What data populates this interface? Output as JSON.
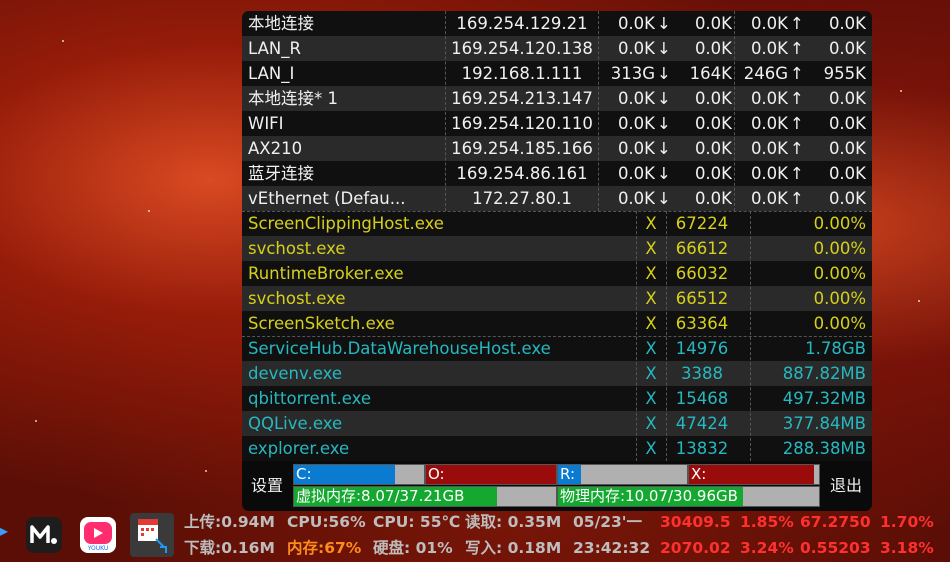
{
  "network": [
    {
      "name": "本地连接",
      "ip": "169.254.129.21",
      "down_total": "0.0K",
      "down_arrow": "↓:",
      "down_speed": "0.0K",
      "up_total": "0.0K",
      "up_arrow": "↑:",
      "up_speed": "0.0K"
    },
    {
      "name": "LAN_R",
      "ip": "169.254.120.138",
      "down_total": "0.0K",
      "down_arrow": "↓:",
      "down_speed": "0.0K",
      "up_total": "0.0K",
      "up_arrow": "↑:",
      "up_speed": "0.0K"
    },
    {
      "name": "LAN_I",
      "ip": "192.168.1.111",
      "down_total": "313G",
      "down_arrow": "↓:",
      "down_speed": "164K",
      "up_total": "246G",
      "up_arrow": "↑:",
      "up_speed": "955K"
    },
    {
      "name": "本地连接* 1",
      "ip": "169.254.213.147",
      "down_total": "0.0K",
      "down_arrow": "↓:",
      "down_speed": "0.0K",
      "up_total": "0.0K",
      "up_arrow": "↑:",
      "up_speed": "0.0K"
    },
    {
      "name": "WIFI",
      "ip": "169.254.120.110",
      "down_total": "0.0K",
      "down_arrow": "↓:",
      "down_speed": "0.0K",
      "up_total": "0.0K",
      "up_arrow": "↑:",
      "up_speed": "0.0K"
    },
    {
      "name": "AX210",
      "ip": "169.254.185.166",
      "down_total": "0.0K",
      "down_arrow": "↓:",
      "down_speed": "0.0K",
      "up_total": "0.0K",
      "up_arrow": "↑:",
      "up_speed": "0.0K"
    },
    {
      "name": "蓝牙连接",
      "ip": "169.254.86.161",
      "down_total": "0.0K",
      "down_arrow": "↓:",
      "down_speed": "0.0K",
      "up_total": "0.0K",
      "up_arrow": "↑:",
      "up_speed": "0.0K"
    },
    {
      "name": "vEthernet (Defau...",
      "ip": "172.27.80.1",
      "down_total": "0.0K",
      "down_arrow": "↓:",
      "down_speed": "0.0K",
      "up_total": "0.0K",
      "up_arrow": "↑:",
      "up_speed": "0.0K"
    }
  ],
  "cpu_processes": [
    {
      "name": "ScreenClippingHost.exe",
      "kill": "X",
      "pid": "67224",
      "value": "0.00%"
    },
    {
      "name": "svchost.exe",
      "kill": "X",
      "pid": "66612",
      "value": "0.00%"
    },
    {
      "name": "RuntimeBroker.exe",
      "kill": "X",
      "pid": "66032",
      "value": "0.00%"
    },
    {
      "name": "svchost.exe",
      "kill": "X",
      "pid": "66512",
      "value": "0.00%"
    },
    {
      "name": "ScreenSketch.exe",
      "kill": "X",
      "pid": "63364",
      "value": "0.00%"
    }
  ],
  "mem_processes": [
    {
      "name": "ServiceHub.DataWarehouseHost.exe",
      "kill": "X",
      "pid": "14976",
      "value": "1.78GB"
    },
    {
      "name": "devenv.exe",
      "kill": "X",
      "pid": "3388",
      "value": "887.82MB"
    },
    {
      "name": "qbittorrent.exe",
      "kill": "X",
      "pid": "15468",
      "value": "497.32MB"
    },
    {
      "name": "QQLive.exe",
      "kill": "X",
      "pid": "47424",
      "value": "377.84MB"
    },
    {
      "name": "explorer.exe",
      "kill": "X",
      "pid": "13832",
      "value": "288.38MB"
    }
  ],
  "footer": {
    "settings_label": "设置",
    "exit_label": "退出",
    "drives": [
      {
        "label": "C:",
        "fill": 0.78,
        "color": "#0a7bd0"
      },
      {
        "label": "O:",
        "fill": 1.0,
        "color": "#9a0c0c"
      },
      {
        "label": "R:",
        "fill": 0.18,
        "color": "#0a7bd0"
      },
      {
        "label": "X:",
        "fill": 0.96,
        "color": "#9a0c0c"
      }
    ],
    "virtual_memory": {
      "label": "虚拟内存:8.07/37.21GB",
      "fill": 0.775,
      "color": "#14a830"
    },
    "physical_memory": {
      "label": "物理内存:10.07/30.96GB",
      "fill": 0.71,
      "color": "#14a830"
    }
  },
  "tray": {
    "upload": "上传:0.94M",
    "download": "下载:0.16M",
    "cpu_usage": "CPU:56%",
    "memory": "内存:67%",
    "cpu_temp": "CPU: 55℃",
    "disk": "硬盘: 01%",
    "read": "读取: 0.35M",
    "write": "写入: 0.18M",
    "date": "05/23'一",
    "time": "23:42:32",
    "stat1": "30409.5",
    "stat2": "1.85%",
    "stat3": "67.2750",
    "stat4": "1.70%",
    "stat5": "2070.02",
    "stat6": "3.24%",
    "stat7": "0.55203",
    "stat8": "3.18%"
  },
  "taskbar_icons": [
    "mango-tv-icon",
    "youku-icon",
    "calendar-network-icon"
  ]
}
